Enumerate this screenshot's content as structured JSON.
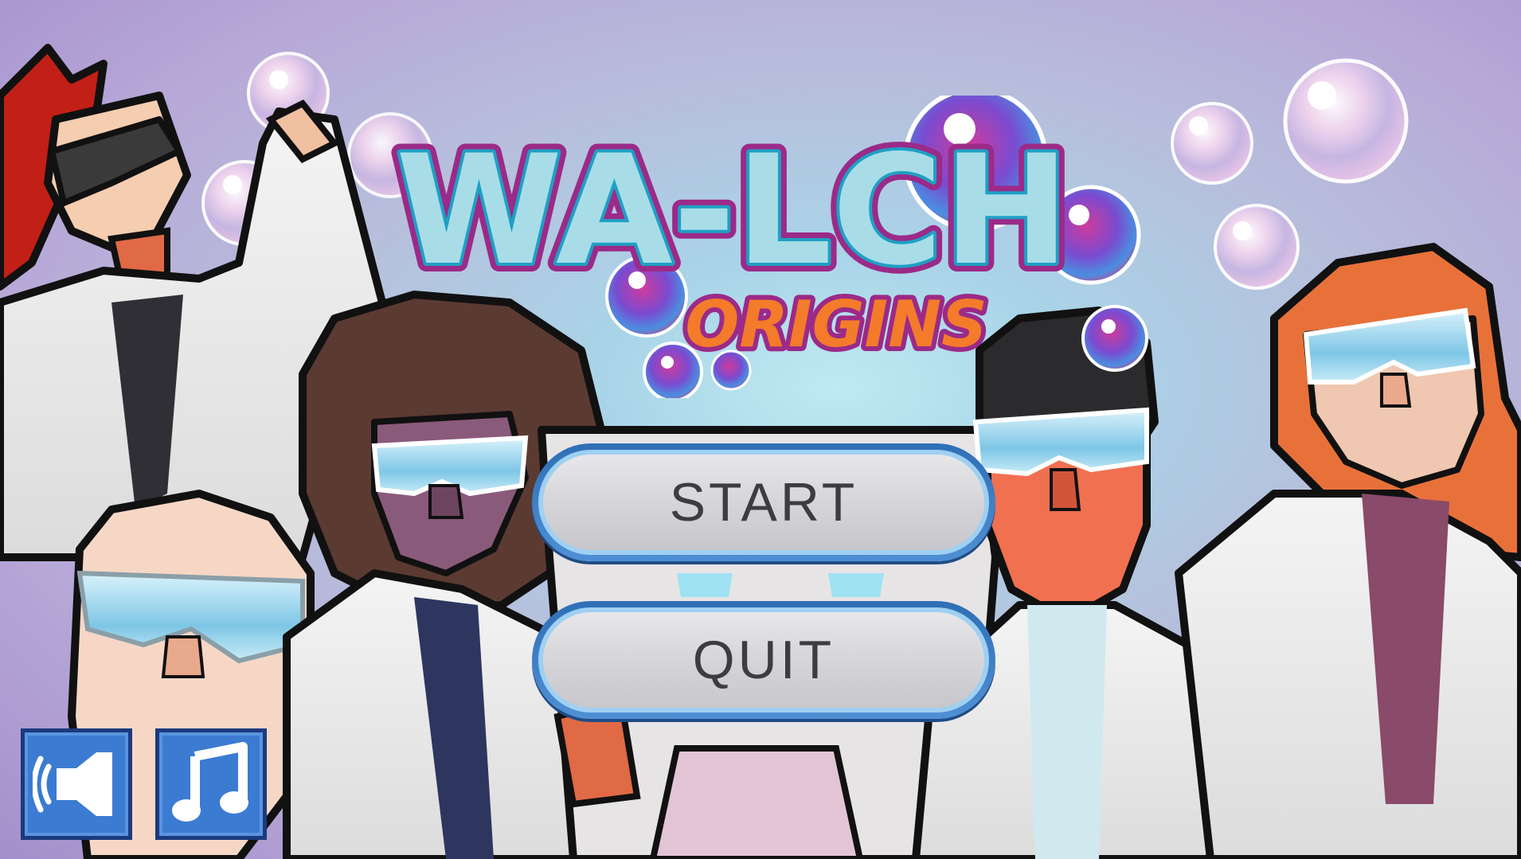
{
  "game": {
    "title_main": "WA-LCH",
    "title_sub": "ORIGINS"
  },
  "menu": {
    "start_label": "START",
    "quit_label": "QUIT"
  },
  "settings": {
    "sound_icon": "speaker-icon",
    "music_icon": "music-note-icon"
  },
  "colors": {
    "title_fill": "#a8dde8",
    "title_outline": "#1ea0c4",
    "title_border": "#9b2a88",
    "subtitle_fill": "#f37b2a",
    "button_border": "#3f80c8",
    "icon_button_fill": "#3c7bd2"
  }
}
